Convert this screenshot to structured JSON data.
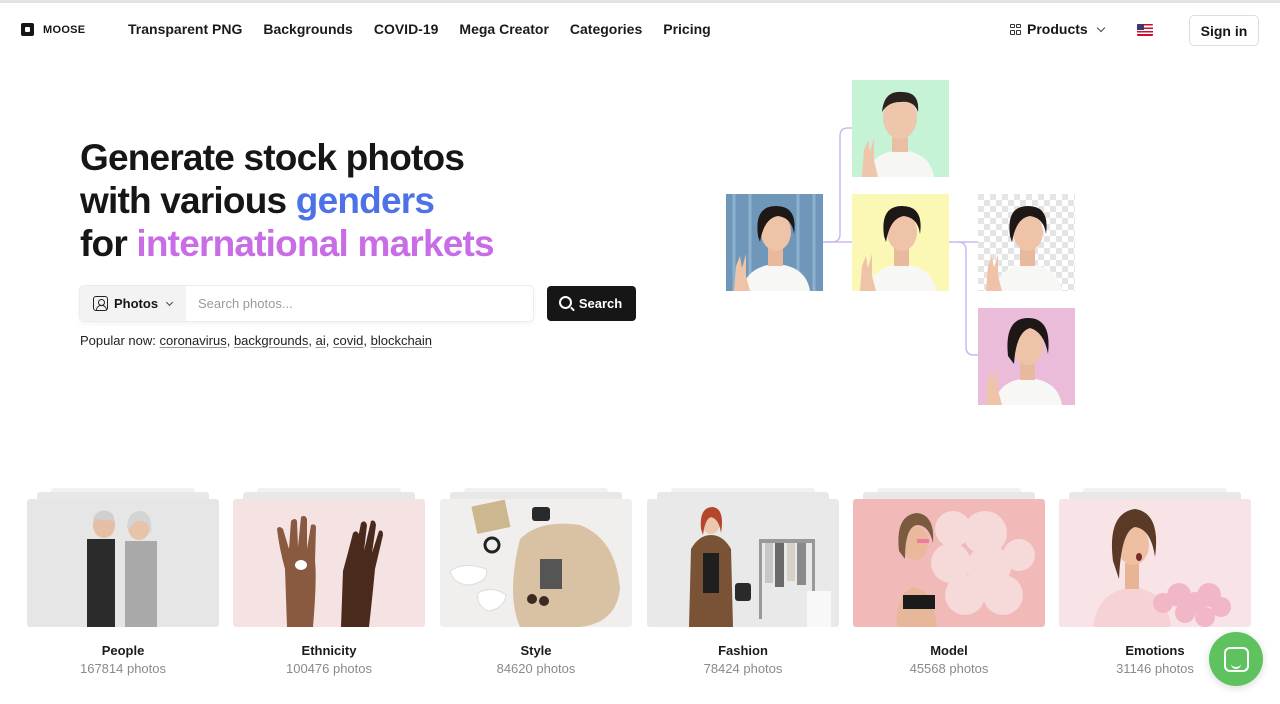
{
  "brand": {
    "name": "MOOSE"
  },
  "nav": {
    "items": [
      {
        "label": "Transparent PNG"
      },
      {
        "label": "Backgrounds"
      },
      {
        "label": "COVID-19"
      },
      {
        "label": "Mega Creator"
      },
      {
        "label": "Categories"
      },
      {
        "label": "Pricing"
      }
    ],
    "products_label": "Products",
    "signin_label": "Sign in"
  },
  "hero": {
    "line1": "Generate stock photos",
    "line2_prefix": "with various ",
    "line2_highlight": "genders",
    "line3_prefix": "for ",
    "line3_highlight": "international markets",
    "highlight_colors": {
      "blue": "#4c72e6",
      "purple": "#c86de6"
    }
  },
  "search": {
    "type_label": "Photos",
    "placeholder": "Search photos...",
    "value": "",
    "button_label": "Search"
  },
  "popular": {
    "prefix": "Popular now:",
    "terms": [
      "coronavirus",
      "backgrounds",
      "ai",
      "covid",
      "blockchain"
    ]
  },
  "categories": [
    {
      "name": "People",
      "count": "167814 photos"
    },
    {
      "name": "Ethnicity",
      "count": "100476 photos"
    },
    {
      "name": "Style",
      "count": "84620 photos"
    },
    {
      "name": "Fashion",
      "count": "78424 photos"
    },
    {
      "name": "Model",
      "count": "45568 photos"
    },
    {
      "name": "Emotions",
      "count": "31146 photos"
    }
  ],
  "icons": {
    "logo": "moose-logo-icon",
    "products": "grid-icon",
    "language": "us-flag-icon",
    "search": "search-icon",
    "type": "photo-icon",
    "chat": "chat-icon"
  },
  "colors": {
    "accent_dark": "#161616",
    "chat_green": "#5ec35e"
  }
}
